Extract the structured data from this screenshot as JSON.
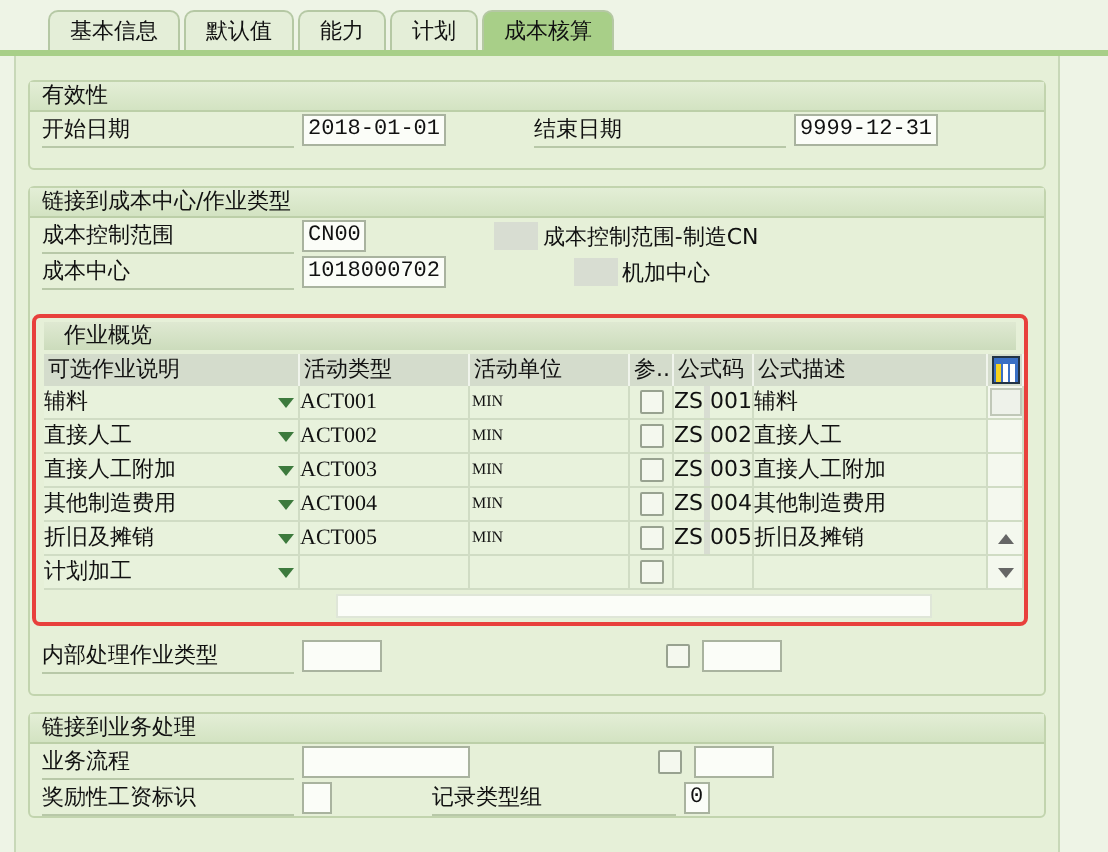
{
  "tabs": [
    {
      "label": "基本信息",
      "selected": false
    },
    {
      "label": "默认值",
      "selected": false
    },
    {
      "label": "能力",
      "selected": false
    },
    {
      "label": "计划",
      "selected": false
    },
    {
      "label": "成本核算",
      "selected": true
    }
  ],
  "validity": {
    "title": "有效性",
    "start_label": "开始日期",
    "start_value": "2018-01-01",
    "end_label": "结束日期",
    "end_value": "9999-12-31"
  },
  "cost_center_link": {
    "title": "链接到成本中心/作业类型",
    "rows": [
      {
        "label": "成本控制范围",
        "value": "CN00",
        "description": "成本控制范围-制造CN"
      },
      {
        "label": "成本中心",
        "value": "1018000702",
        "description": "机加中心"
      }
    ]
  },
  "activity_overview": {
    "title": "作业概览",
    "columns": [
      "可选作业说明",
      "活动类型",
      "活动单位",
      "参..",
      "公式码",
      "公式描述"
    ],
    "rows": [
      {
        "description": "辅料",
        "activity_type": "ACT001",
        "unit": "MIN",
        "checked": false,
        "code_start": "ZS",
        "code_end": "001",
        "formula_description": "辅料"
      },
      {
        "description": "直接人工",
        "activity_type": "ACT002",
        "unit": "MIN",
        "checked": false,
        "code_start": "ZS",
        "code_end": "002",
        "formula_description": "直接人工"
      },
      {
        "description": "直接人工附加",
        "activity_type": "ACT003",
        "unit": "MIN",
        "checked": false,
        "code_start": "ZS",
        "code_end": "003",
        "formula_description": "直接人工附加"
      },
      {
        "description": "其他制造费用",
        "activity_type": "ACT004",
        "unit": "MIN",
        "checked": false,
        "code_start": "ZS",
        "code_end": "004",
        "formula_description": "其他制造费用"
      },
      {
        "description": "折旧及摊销",
        "activity_type": "ACT005",
        "unit": "MIN",
        "checked": false,
        "code_start": "ZS",
        "code_end": "005",
        "formula_description": "折旧及摊销"
      },
      {
        "description": "计划加工",
        "checked": false
      }
    ]
  },
  "internal_processing": {
    "label": "内部处理作业类型",
    "checked": false
  },
  "business_process_link": {
    "title": "链接到业务处理",
    "process_label": "业务流程",
    "process_checked": false,
    "incentive_label": "奖励性工资标识",
    "incentive_checked": false,
    "record_group_label": "记录类型组",
    "record_group_value": "0"
  }
}
